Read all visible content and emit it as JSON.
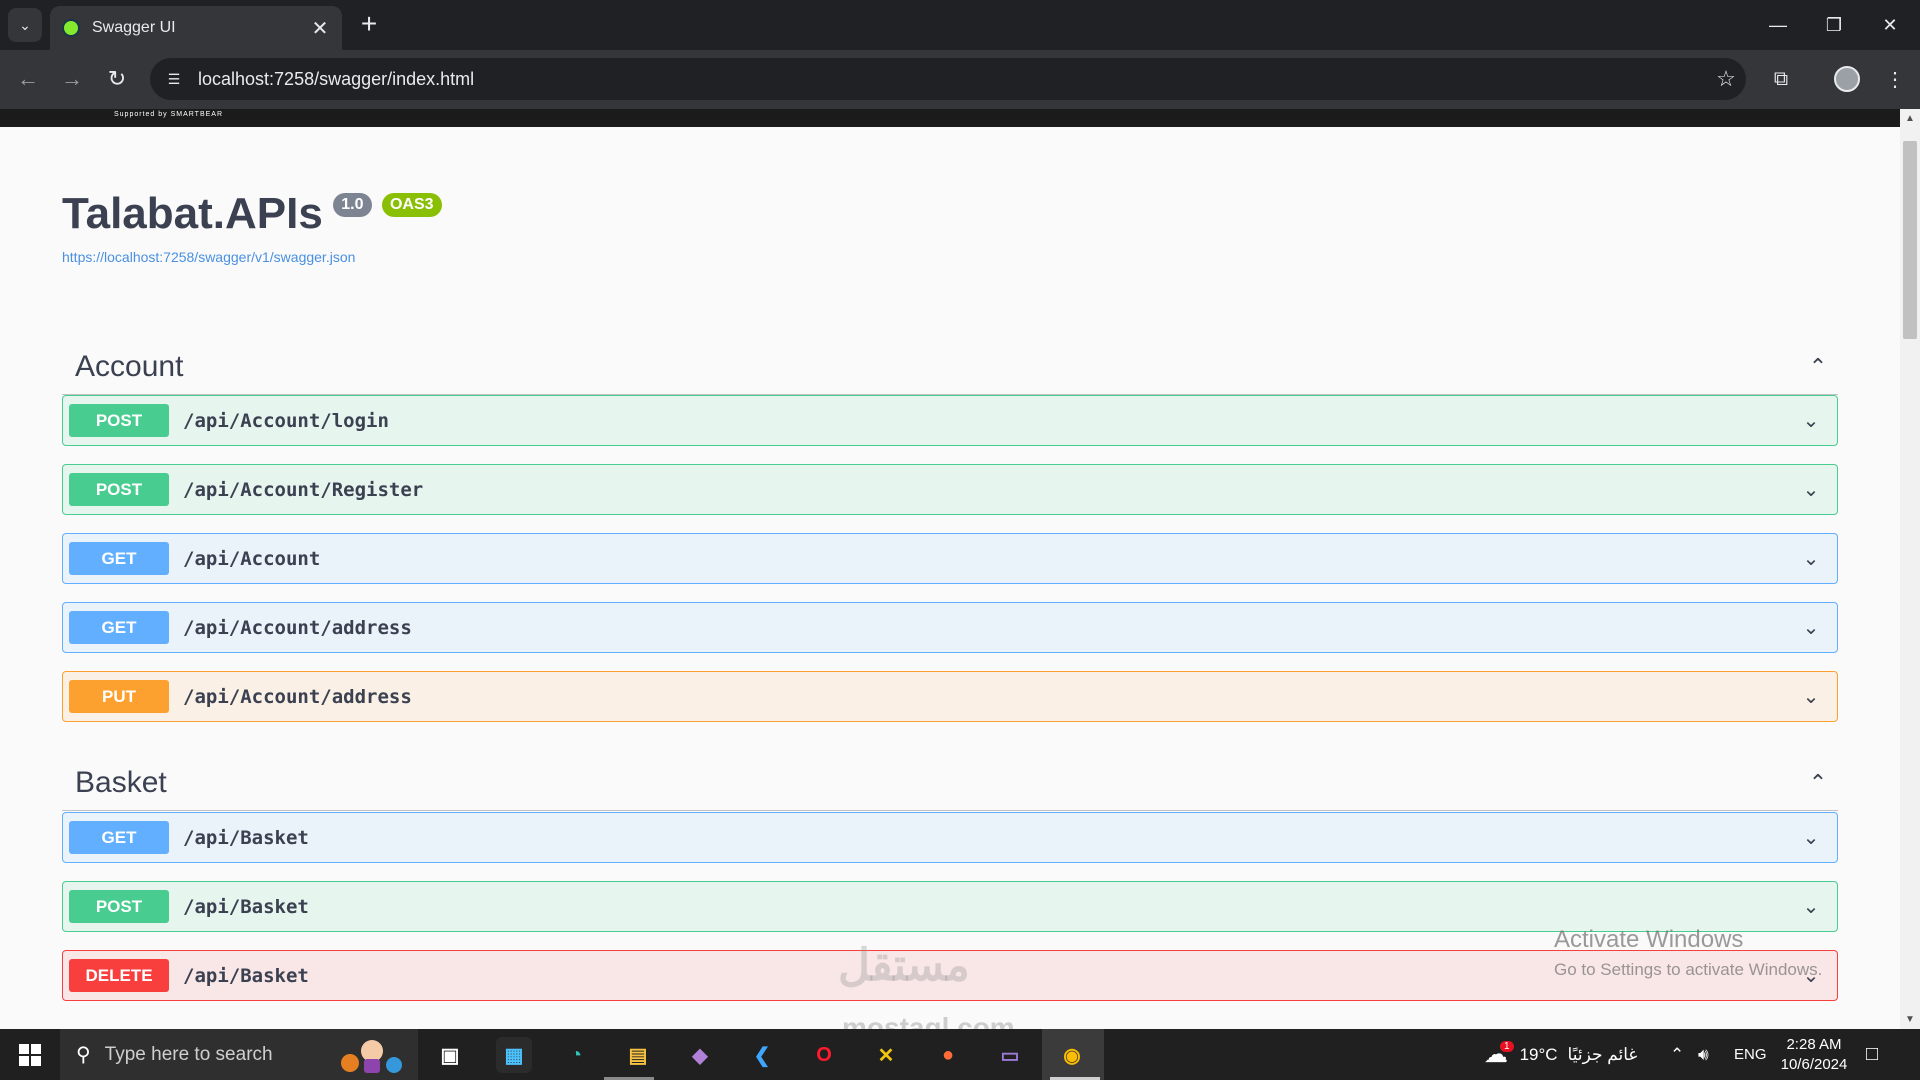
{
  "browser": {
    "tab_title": "Swagger UI",
    "url": "localhost:7258/swagger/index.html"
  },
  "page": {
    "topbar_supported": "Supported by SMARTBEAR",
    "title": "Talabat.APIs",
    "version": "1.0",
    "oas_badge": "OAS3",
    "spec_link": "https://localhost:7258/swagger/v1/swagger.json"
  },
  "tags": [
    {
      "name": "Account",
      "operations": [
        {
          "method": "POST",
          "path": "/api/Account/login"
        },
        {
          "method": "POST",
          "path": "/api/Account/Register"
        },
        {
          "method": "GET",
          "path": "/api/Account"
        },
        {
          "method": "GET",
          "path": "/api/Account/address"
        },
        {
          "method": "PUT",
          "path": "/api/Account/address"
        }
      ]
    },
    {
      "name": "Basket",
      "operations": [
        {
          "method": "GET",
          "path": "/api/Basket"
        },
        {
          "method": "POST",
          "path": "/api/Basket"
        },
        {
          "method": "DELETE",
          "path": "/api/Basket"
        }
      ]
    }
  ],
  "method_colors": {
    "POST": "#49cc90",
    "GET": "#61affe",
    "PUT": "#fca130",
    "DELETE": "#f93e3e"
  },
  "overlay": {
    "activate_title": "Activate Windows",
    "activate_sub": "Go to Settings to activate Windows.",
    "watermark": "مستقل",
    "watermark_sub": "mostaql.com"
  },
  "taskbar": {
    "search_placeholder": "Type here to search",
    "weather_temp": "19°C",
    "weather_text": "غائم جزئيًا",
    "language": "ENG",
    "time": "2:28 AM",
    "date": "10/6/2024",
    "weather_badge": "1"
  }
}
